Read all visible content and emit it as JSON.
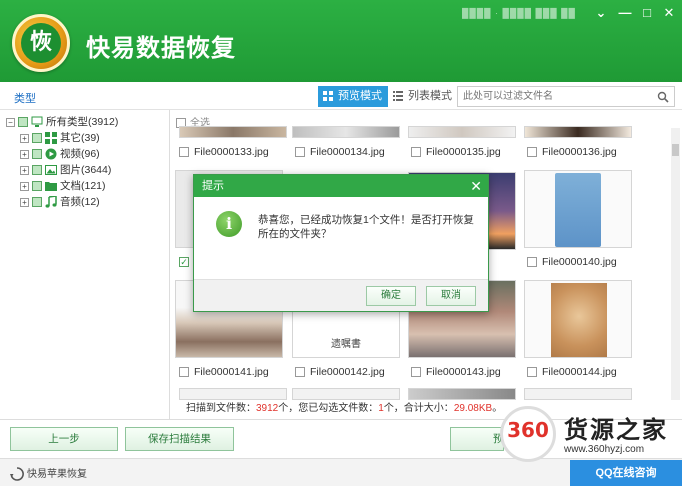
{
  "app": {
    "title": "快易数据恢复",
    "logo_char": "恢",
    "blurred_info": "████ · ████ ███ ██"
  },
  "window": {
    "minimize": "⌄",
    "min2": "—",
    "maximize": "□",
    "close": "✕"
  },
  "toolbar": {
    "type_label": "类型",
    "preview_mode": "预览模式",
    "list_mode": "列表模式",
    "search_placeholder": "此处可以过滤文件名"
  },
  "tree": [
    {
      "label": "所有类型(3912)",
      "icon": "computer-icon",
      "level": 0
    },
    {
      "label": "其它(39)",
      "icon": "grid-icon",
      "level": 1
    },
    {
      "label": "视频(96)",
      "icon": "video-icon",
      "level": 1
    },
    {
      "label": "图片(3644)",
      "icon": "image-icon",
      "level": 1
    },
    {
      "label": "文档(121)",
      "icon": "folder-icon",
      "level": 1
    },
    {
      "label": "音频(12)",
      "icon": "music-icon",
      "level": 1
    }
  ],
  "content": {
    "select_all": "全选",
    "files": [
      {
        "name": "File0000133.jpg",
        "checked": false
      },
      {
        "name": "File0000134.jpg",
        "checked": false
      },
      {
        "name": "File0000135.jpg",
        "checked": false
      },
      {
        "name": "File0000136.jpg",
        "checked": false
      },
      {
        "name": "",
        "checked": true
      },
      {
        "name": "File0000140.jpg",
        "checked": false
      },
      {
        "name": "File0000141.jpg",
        "checked": false
      },
      {
        "name": "File0000142.jpg",
        "checked": false
      },
      {
        "name": "File0000143.jpg",
        "checked": false
      },
      {
        "name": "File0000144.jpg",
        "checked": false
      }
    ],
    "thumb_caption": "遗嘱書"
  },
  "status": {
    "prefix": "扫描到文件数：",
    "scanned": "3912",
    "mid": "个，您已勾选文件数：",
    "selected": "1",
    "mid2": "个，合计大小：",
    "size": "29.08KB",
    "suffix": "。"
  },
  "buttons": {
    "prev": "上一步",
    "save_scan": "保存扫描结果",
    "preview_partial": "预"
  },
  "footer": {
    "label": "快易苹果恢复",
    "qq": "QQ在线咨询"
  },
  "watermark": {
    "logo": "360",
    "text": "货源之家",
    "url": "www.360hyzj.com"
  },
  "dialog": {
    "title": "提示",
    "close": "✕",
    "message": "恭喜您，已经成功恢复1个文件！是否打开恢复所在的文件夹？",
    "ok": "确定",
    "cancel": "取消"
  }
}
